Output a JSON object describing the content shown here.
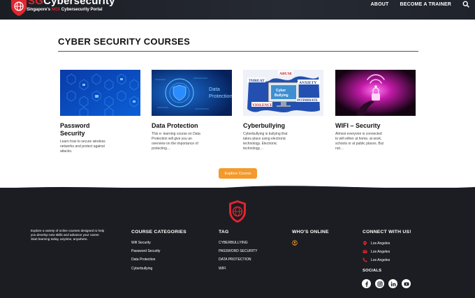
{
  "header": {
    "brand_prefix": "SG",
    "brand_suffix": "Cybersecurity",
    "tagline_pre": "Singapore's ",
    "tagline_hl": "NO1",
    "tagline_post": " Cybersecurity Portal",
    "nav": [
      "ABOUT",
      "BECOME A TRAINER"
    ],
    "search_icon": "search-icon"
  },
  "courses": {
    "title": "CYBER SECURITY COURSES",
    "items": [
      {
        "title": "Password Security",
        "title_line1": "Password",
        "title_line2": "Security",
        "desc": "Learn how to secure wireless networks and protect against attacks."
      },
      {
        "title": "Data Protection",
        "desc": "This e- learning course on Data Protection will give you an overview on the importance of protecting…",
        "image_text": "Data Protection"
      },
      {
        "title": "Cyberbullying",
        "desc": "Cyberbullying is bullying that takes place using electronic technology. Electronic technology…",
        "image_words": [
          "ABUSE",
          "THREAT",
          "ANXIETY",
          "INTIMIDATE",
          "VIOLENCE",
          "Cyber Bullying"
        ]
      },
      {
        "title": "WIFI – Security",
        "desc": "Almost everyone is connected to wifi either at home, at work, schools or at public places. But not…"
      }
    ],
    "explore_label": "Explore Course"
  },
  "footer": {
    "about": "Explore a variety of online courses designed to help you develop new skills and advance your career. Start learning today, anytime, anywhere.",
    "categories": {
      "heading": "COURSE CATEGORIES",
      "items": [
        "Wifi Security",
        "Password Security",
        "Data Protection",
        "Cyberbullying"
      ]
    },
    "tags": {
      "heading": "TAG",
      "items": [
        "CYBERBULLYING",
        "PASSWORD SECURITY",
        "DATA PROTECTION",
        "WIFI"
      ]
    },
    "online": {
      "heading": "WHO'S ONLINE",
      "icon": "user-circle-icon"
    },
    "connect": {
      "heading": "CONNECT WITH US!",
      "items": [
        {
          "icon": "location-pin-icon",
          "text": "Los Angeles"
        },
        {
          "icon": "mail-icon",
          "text": "Los Angeles"
        },
        {
          "icon": "phone-icon",
          "text": "Los Angeles"
        }
      ]
    },
    "socials": {
      "heading": "SOCIALS",
      "items": [
        "facebook-icon",
        "instagram-icon",
        "linkedin-icon",
        "youtube-icon"
      ]
    }
  },
  "colors": {
    "header_bg": "#1b1d24",
    "brand_red": "#e0262f",
    "accent_orange": "#f39a2b",
    "footer_bg": "#1b1d22"
  }
}
